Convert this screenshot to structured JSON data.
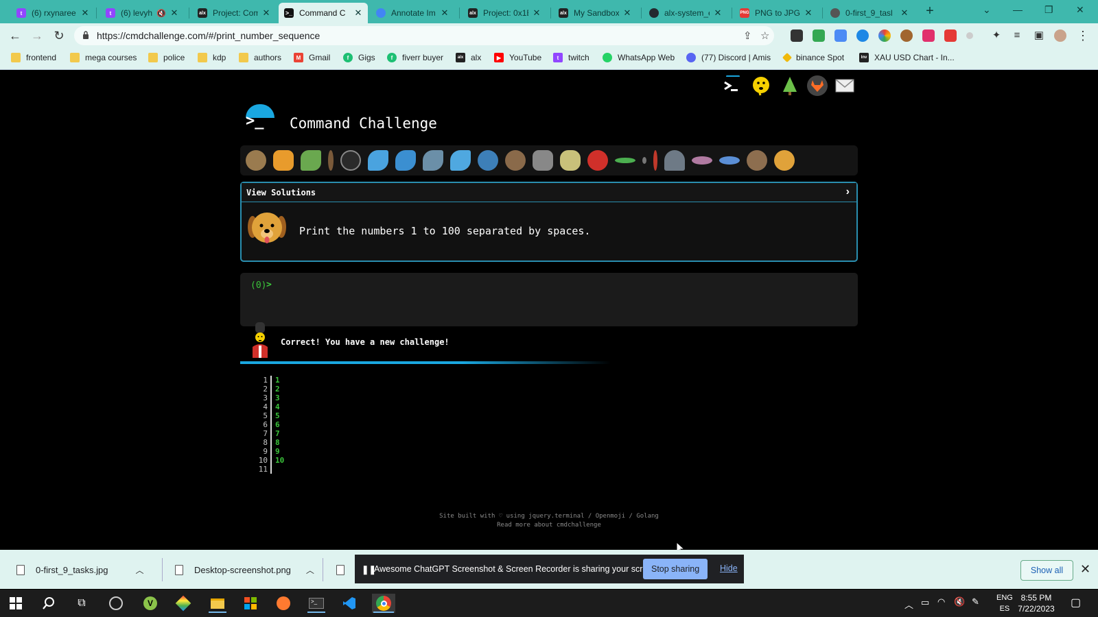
{
  "browser": {
    "tabs": [
      {
        "title": "(6) rxynaree",
        "favicon": "twitch-icon",
        "color": "#9146ff"
      },
      {
        "title": "(6) levyh",
        "favicon": "twitch-icon",
        "color": "#9146ff"
      },
      {
        "title": "Project: Com",
        "favicon": "alx-icon",
        "color": "#222222"
      },
      {
        "title": "Command C",
        "favicon": "terminal-icon",
        "color": "#111111"
      },
      {
        "title": "Annotate Im",
        "favicon": "chrome-icon",
        "color": "#4285f4"
      },
      {
        "title": "Project: 0x1E",
        "favicon": "alx-icon",
        "color": "#222222"
      },
      {
        "title": "My Sandbox",
        "favicon": "alx-icon",
        "color": "#222222"
      },
      {
        "title": "alx-system_e",
        "favicon": "github-icon",
        "color": "#24292f"
      },
      {
        "title": "PNG to JPG",
        "favicon": "png-icon",
        "color": "#e53935"
      },
      {
        "title": "0-first_9_tasl",
        "favicon": "globe-icon",
        "color": "#555555"
      }
    ],
    "url": "https://cmdchallenge.com/#/print_number_sequence",
    "bookmarks": [
      {
        "label": "frontend",
        "icon": "folder-icon",
        "color": "#f2c94c"
      },
      {
        "label": "mega courses",
        "icon": "folder-icon",
        "color": "#f2c94c"
      },
      {
        "label": "police",
        "icon": "folder-icon",
        "color": "#f2c94c"
      },
      {
        "label": "kdp",
        "icon": "folder-icon",
        "color": "#f2c94c"
      },
      {
        "label": "authors",
        "icon": "folder-icon",
        "color": "#f2c94c"
      },
      {
        "label": "Gmail",
        "icon": "gmail-icon",
        "color": "#ea4335"
      },
      {
        "label": "Gigs",
        "icon": "fiverr-icon",
        "color": "#1dbf73"
      },
      {
        "label": "fiverr buyer",
        "icon": "fiverr-icon",
        "color": "#1dbf73"
      },
      {
        "label": "alx",
        "icon": "alx-icon",
        "color": "#222222"
      },
      {
        "label": "YouTube",
        "icon": "youtube-icon",
        "color": "#ff0000"
      },
      {
        "label": "twitch",
        "icon": "twitch-icon",
        "color": "#9146ff"
      },
      {
        "label": "WhatsApp Web",
        "icon": "whatsapp-icon",
        "color": "#25d366"
      },
      {
        "label": "(77) Discord | Amis",
        "icon": "discord-icon",
        "color": "#5865f2"
      },
      {
        "label": "binance Spot",
        "icon": "binance-icon",
        "color": "#f0b90b"
      },
      {
        "label": "XAU USD Chart - In...",
        "icon": "investing-icon",
        "color": "#222222"
      }
    ]
  },
  "site": {
    "title": "Command Challenge",
    "view_solutions": "View Solutions",
    "challenge": "Print the numbers 1 to 100 separated by spaces.",
    "prompt_count": "(0)",
    "prompt_arrow": ">",
    "result": "Correct! You have a new challenge!",
    "output_lines": [
      {
        "n": "1",
        "v": "1"
      },
      {
        "n": "2",
        "v": "2"
      },
      {
        "n": "3",
        "v": "3"
      },
      {
        "n": "4",
        "v": "4"
      },
      {
        "n": "5",
        "v": "5"
      },
      {
        "n": "6",
        "v": "6"
      },
      {
        "n": "7",
        "v": "7"
      },
      {
        "n": "8",
        "v": "8"
      },
      {
        "n": "9",
        "v": "9"
      },
      {
        "n": "10",
        "v": "10"
      },
      {
        "n": "11",
        "v": ""
      }
    ],
    "footer_line1": "Site built with ♡ using jquery.terminal / Openmoji / Golang",
    "footer_line2": "Read more about cmdchallenge",
    "accent_color": "#1aa7e0",
    "prompt_color": "#3bc43b"
  },
  "downloads": {
    "items": [
      "0-first_9_tasks.jpg",
      "Desktop-screenshot.png"
    ],
    "share_message": "Awesome ChatGPT Screenshot & Screen Recorder is sharing your screen.",
    "stop_sharing": "Stop sharing",
    "hide": "Hide",
    "show_all": "Show all"
  },
  "taskbar": {
    "time": "8:55 PM",
    "date": "7/22/2023",
    "lang_top": "ENG",
    "lang_bottom": "ES"
  }
}
